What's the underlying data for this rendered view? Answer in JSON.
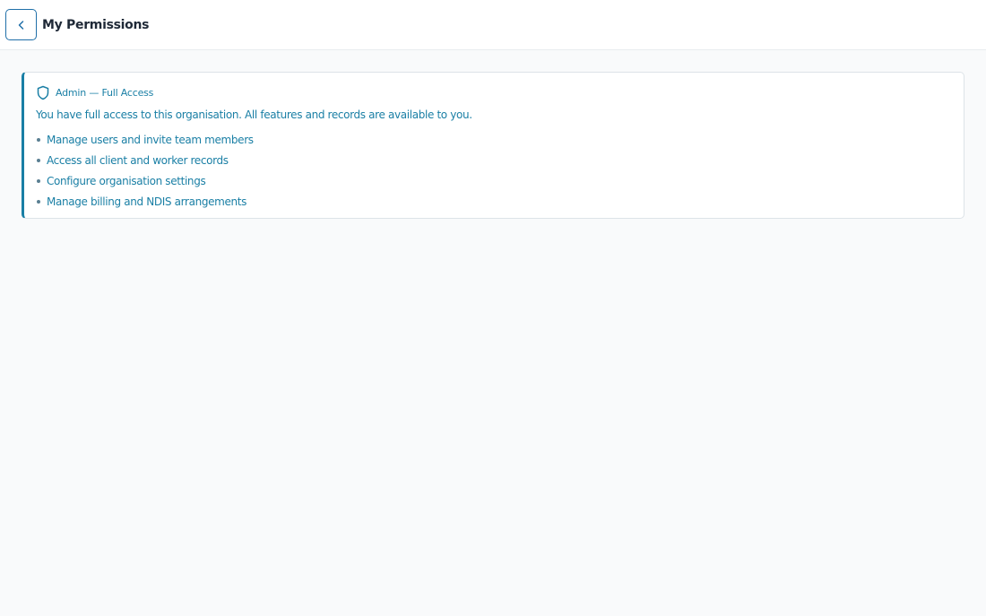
{
  "header": {
    "title": "My Permissions",
    "back_icon": "chevron-left-icon"
  },
  "role_card": {
    "icon": "shield-icon",
    "role_label": "Admin — Full Access",
    "description": "You have full access to this organisation. All features and records are available to you.",
    "permissions": [
      "Manage users and invite team members",
      "Access all client and worker records",
      "Configure organisation settings",
      "Manage billing and NDIS arrangements"
    ]
  },
  "colors": {
    "accent": "#1a7fa5",
    "header_border": "#1f6fa8",
    "background": "#f9fafb"
  }
}
